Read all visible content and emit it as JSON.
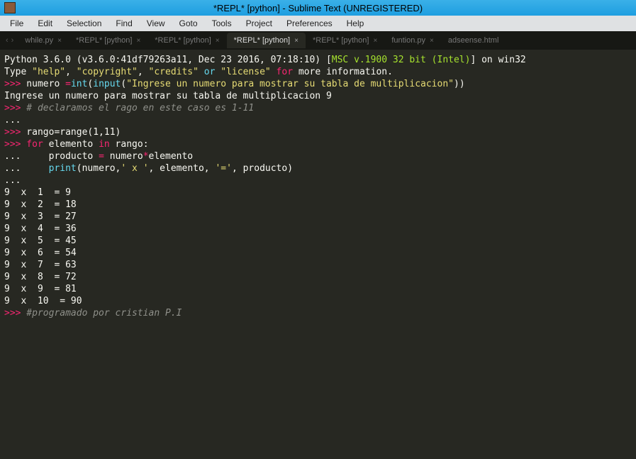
{
  "window": {
    "title": "*REPL* [python] - Sublime Text (UNREGISTERED)"
  },
  "menu": [
    "File",
    "Edit",
    "Selection",
    "Find",
    "View",
    "Goto",
    "Tools",
    "Project",
    "Preferences",
    "Help"
  ],
  "tabs": {
    "arrowLeft": "‹",
    "arrowRight": "›",
    "items": [
      {
        "label": "while.py",
        "active": false
      },
      {
        "label": "*REPL* [python]",
        "active": false
      },
      {
        "label": "*REPL* [python]",
        "active": false
      },
      {
        "label": "*REPL* [python]",
        "active": true
      },
      {
        "label": "*REPL* [python]",
        "active": false
      },
      {
        "label": "funtion.py",
        "active": false
      },
      {
        "label": "adseense.html",
        "active": false
      }
    ]
  },
  "repl": {
    "banner1_a": "Python 3.6.0 (v3.6.0:41df79263a11, Dec 23 2016, 07:18:10) ",
    "banner1_b": "[",
    "banner1_c": "MSC v.1900 32 bit (Intel)",
    "banner1_d": "]",
    "banner1_e": " on win32",
    "banner2_a": "Type ",
    "banner2_b": "\"help\"",
    "banner2_c": ", ",
    "banner2_d": "\"copyright\"",
    "banner2_e": ", ",
    "banner2_f": "\"credits\"",
    "banner2_g": " or ",
    "banner2_h": "\"license\"",
    "banner2_i": " for",
    "banner2_j": " more information.",
    "prompt": ">>>",
    "cont": "...",
    "line1_a": " numero ",
    "line1_b": "=",
    "line1_c": "int",
    "line1_d": "(",
    "line1_e": "input",
    "line1_f": "(",
    "line1_g": "\"Ingrese un numero para mostrar su tabla de multiplicacion\"",
    "line1_h": "))",
    "out1": "Ingrese un numero para mostrar su tabla de multiplicacion 9",
    "comment1": " # declaramos el rago en este caso es 1-11",
    "line2": " rango=range(1,11)",
    "line3_a": " for",
    "line3_b": " elemento ",
    "line3_c": "in",
    "line3_d": " rango:",
    "line4_a": "     producto ",
    "line4_b": "=",
    "line4_c": " numero",
    "line4_d": "*",
    "line4_e": "elemento",
    "line5_a": "     print",
    "line5_b": "(",
    "line5_c": "numero,",
    "line5_d": "' x '",
    "line5_e": ", elemento, ",
    "line5_f": "'='",
    "line5_g": ", producto",
    "line5_h": ")",
    "table": [
      "9  x  1  = 9",
      "9  x  2  = 18",
      "9  x  3  = 27",
      "9  x  4  = 36",
      "9  x  5  = 45",
      "9  x  6  = 54",
      "9  x  7  = 63",
      "9  x  8  = 72",
      "9  x  9  = 81",
      "9  x  10  = 90"
    ],
    "comment2": " #programado por cristian P.I"
  }
}
